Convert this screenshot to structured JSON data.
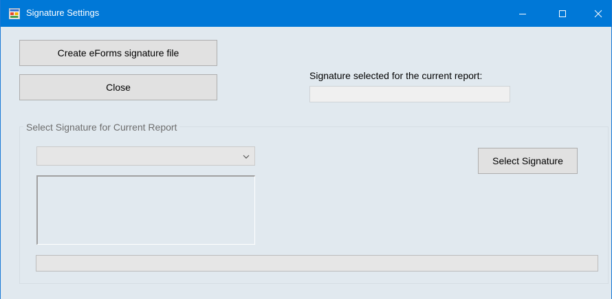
{
  "window": {
    "title": "Signature Settings",
    "title_icon": "app-form-icon",
    "controls": [
      "minimize-icon",
      "maximize-icon",
      "close-icon"
    ],
    "accent_color": "#0078d7"
  },
  "buttons": {
    "create_label": "Create eForms signature file",
    "close_label": "Close",
    "select_signature_label": "Select Signature"
  },
  "current_signature": {
    "label": "Signature selected for the current report:",
    "value": ""
  },
  "select_group": {
    "legend": "Select Signature for Current Report",
    "dropdown_value": "",
    "list_items": [],
    "progress": 0
  }
}
